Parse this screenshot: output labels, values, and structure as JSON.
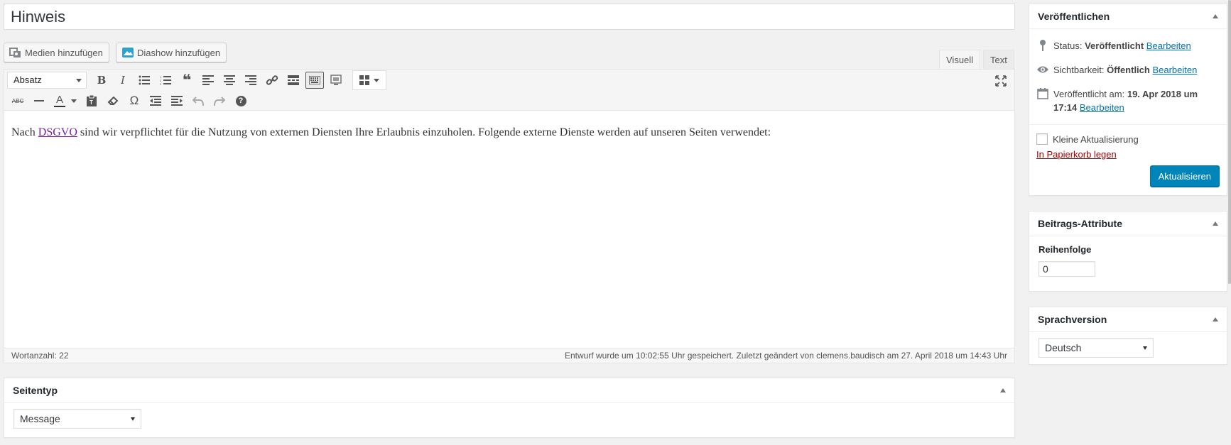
{
  "title": {
    "value": "Hinweis"
  },
  "media_buttons": {
    "add_media": "Medien hinzufügen",
    "add_slideshow": "Diashow hinzufügen"
  },
  "editor_tabs": {
    "visual": "Visuell",
    "text": "Text"
  },
  "toolbar": {
    "format_select": "Absatz",
    "bold": "B",
    "italic": "I",
    "strikethrough": "ABC",
    "text_color": "A",
    "special_char": "Ω",
    "help": "?"
  },
  "content": {
    "before": "Nach ",
    "link": "DSGVO",
    "after": " sind wir verpflichtet für die Nutzung von externen Diensten Ihre Erlaubnis einzuholen. Folgende externe Dienste werden auf unseren Seiten verwendet:"
  },
  "status_bar": {
    "word_count": "Wortanzahl: 22",
    "autosave": "Entwurf wurde um 10:02:55 Uhr gespeichert. Zuletzt geändert von clemens.baudisch am 27. April 2018 um 14:43 Uhr"
  },
  "seitentyp": {
    "title": "Seitentyp",
    "selected": "Message"
  },
  "publish": {
    "title": "Veröffentlichen",
    "status_label": "Status:",
    "status_value": "Veröffentlicht",
    "visibility_label": "Sichtbarkeit:",
    "visibility_value": "Öffentlich",
    "published_label": "Veröffentlicht am:",
    "published_date": "19. Apr 2018 um",
    "published_time": "17:14",
    "edit_link": "Bearbeiten",
    "minor_update": "Kleine Aktualisierung",
    "trash_link": "In Papierkorb legen",
    "update_button": "Aktualisieren"
  },
  "attributes": {
    "title": "Beitrags-Attribute",
    "order_label": "Reihenfolge",
    "order_value": "0"
  },
  "language": {
    "title": "Sprachversion",
    "selected": "Deutsch"
  },
  "colors": {
    "primary": "#0085ba",
    "link": "#0073aa",
    "trash": "#a00",
    "visited_link": "#7a1fa2"
  }
}
